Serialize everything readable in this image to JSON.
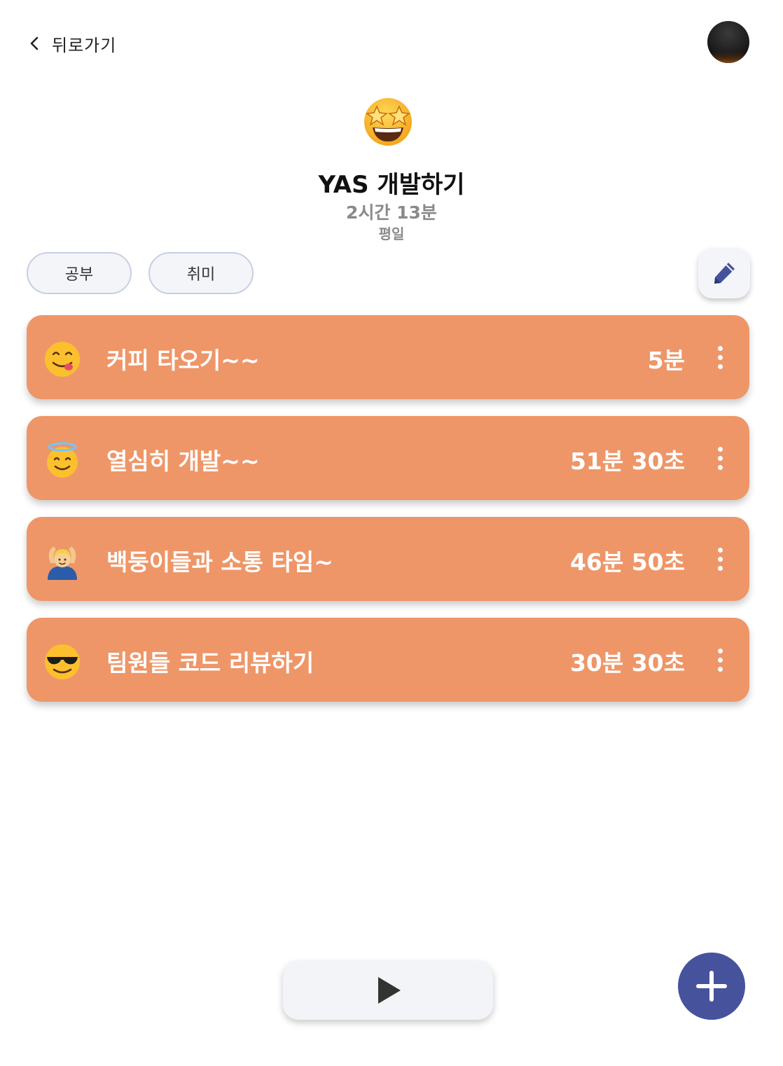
{
  "header": {
    "back_label": "뒤로가기",
    "back_icon": "chevron-left-icon",
    "avatar_icon": "profile-avatar"
  },
  "routine": {
    "icon": "star-struck-emoji",
    "title": "YAS 개발하기",
    "total_time": "2시간 13분",
    "day_type": "평일"
  },
  "tags": [
    {
      "label": "공부"
    },
    {
      "label": "취미"
    }
  ],
  "edit_icon": "pencil-icon",
  "tasks": [
    {
      "emoji": "yum-face-emoji",
      "name": "커피 타오기~~",
      "time": "5분"
    },
    {
      "emoji": "halo-face-emoji",
      "name": "열심히 개발~~",
      "time": "51분 30초"
    },
    {
      "emoji": "ok-gesture-person-emoji",
      "name": "백둥이들과 소통 타임~",
      "time": "46분 50초"
    },
    {
      "emoji": "sunglasses-face-emoji",
      "name": "팀원들 코드 리뷰하기",
      "time": "30분 30초"
    }
  ],
  "controls": {
    "play_icon": "play-icon",
    "add_icon": "plus-icon"
  },
  "colors": {
    "task_bg": "#ee9668",
    "accent": "#46539c",
    "tag_border": "#c9cee6"
  }
}
